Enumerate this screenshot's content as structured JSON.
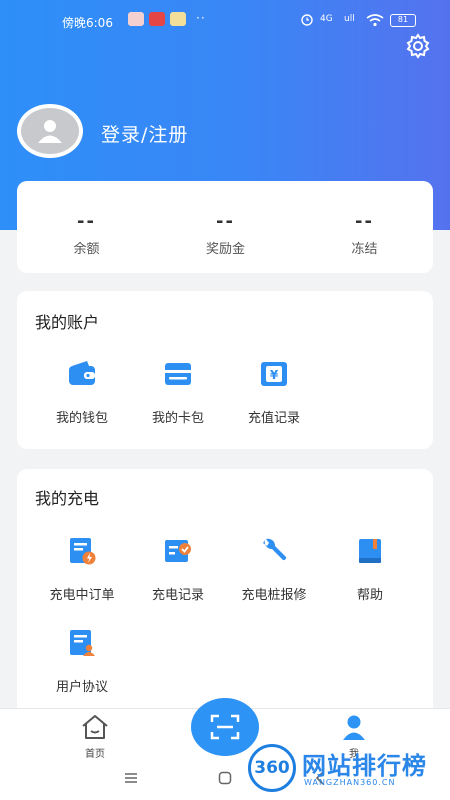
{
  "status_bar": {
    "time": "傍晚6:06",
    "dots": "··",
    "signal1": "4G",
    "signal2": "ull",
    "battery": "81"
  },
  "profile": {
    "login_label": "登录/注册"
  },
  "balance": [
    {
      "value": "--",
      "label": "余额"
    },
    {
      "value": "--",
      "label": "奖励金"
    },
    {
      "value": "--",
      "label": "冻结"
    }
  ],
  "my_account": {
    "title": "我的账户",
    "items": [
      {
        "label": "我的钱包",
        "icon": "wallet-icon"
      },
      {
        "label": "我的卡包",
        "icon": "card-icon"
      },
      {
        "label": "充值记录",
        "icon": "recharge-record-icon"
      }
    ]
  },
  "my_charging": {
    "title": "我的充电",
    "items": [
      {
        "label": "充电中订单",
        "icon": "charging-order-icon"
      },
      {
        "label": "充电记录",
        "icon": "charge-record-icon"
      },
      {
        "label": "充电桩报修",
        "icon": "wrench-icon"
      },
      {
        "label": "帮助",
        "icon": "book-icon"
      },
      {
        "label": "用户协议",
        "icon": "user-agreement-icon"
      }
    ]
  },
  "tabbar": {
    "home": "首页",
    "me": "我"
  },
  "watermark": {
    "badge": "360",
    "title": "网站排行榜",
    "url": "WANGZHAN360.CN"
  },
  "colors": {
    "accent": "#2d93f4",
    "header_start": "#2e8ff8",
    "header_end": "#5572ee"
  }
}
